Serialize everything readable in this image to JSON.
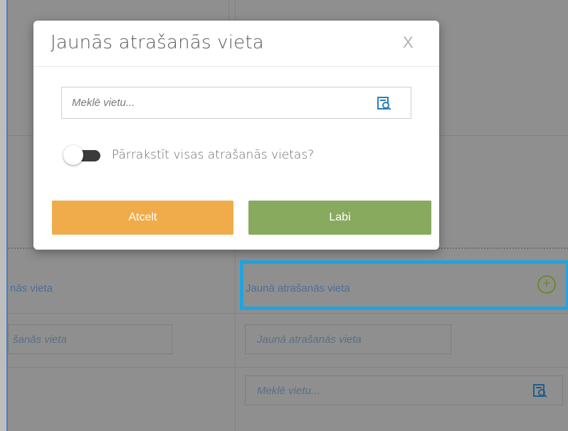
{
  "modal": {
    "title": "Jaunās atrašanās vieta",
    "close_label": "X",
    "search_placeholder": "Meklē vietu...",
    "overwrite_label": "Pārrakstīt visas atrašanās vietas?",
    "overwrite_enabled": false,
    "cancel_label": "Atcelt",
    "ok_label": "Labi"
  },
  "background": {
    "left_row_label": "nās vieta",
    "right_row_label": "Jaunā atrašanās vieta",
    "left_field_value": "šanās vieta",
    "right_field_value": "Jaunā atrašanās vieta",
    "right_search_placeholder": "Meklē vietu..."
  },
  "colors": {
    "cancel": "#f0ab4a",
    "ok": "#88aa5e",
    "highlight": "#21a3e0",
    "plus": "#6b8a2e"
  },
  "icons": [
    "search-list-icon",
    "plus-circle-icon",
    "close-icon"
  ]
}
